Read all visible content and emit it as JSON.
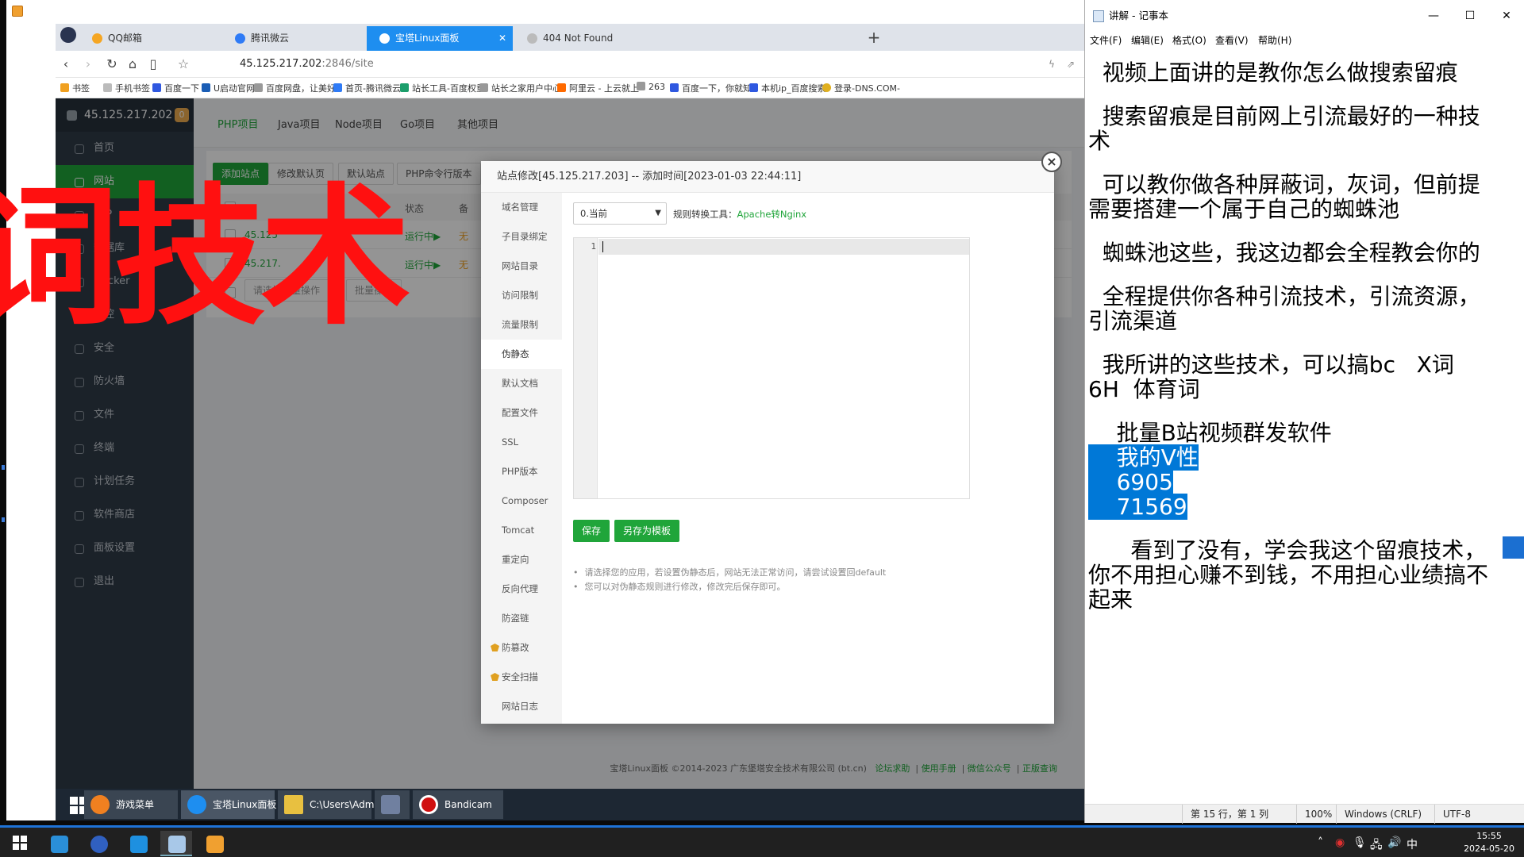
{
  "browser": {
    "tabs": [
      {
        "label": "QQ邮箱",
        "color": "#f5a623"
      },
      {
        "label": "腾讯微云",
        "color": "#2f7bf6"
      },
      {
        "label": "宝塔Linux面板",
        "color": "#1e8ef0"
      },
      {
        "label": "404 Not Found",
        "color": "#888888"
      }
    ],
    "new_tab": "+",
    "url_host": "45.125.217.202",
    "url_path": ":2846/site",
    "bookmarks": [
      "书签",
      "手机书签",
      "百度一下",
      "U启动官网",
      "百度网盘，让美好",
      "首页-腾讯微云",
      "站长工具-百度权重",
      "站长之家用户中心",
      "阿里云 - 上云就上",
      "263",
      "百度一下，你就知",
      "本机ip_百度搜索",
      "登录-DNS.COM-"
    ]
  },
  "bt": {
    "server_ip": "45.125.217.202",
    "badge": "0",
    "sidebar": [
      "首页",
      "网站",
      "FTP",
      "数据库",
      "Docker",
      "监控",
      "安全",
      "防火墙",
      "文件",
      "终端",
      "计划任务",
      "软件商店",
      "面板设置",
      "退出"
    ],
    "top_tabs": [
      "PHP项目",
      "Java项目",
      "Node项目",
      "Go项目",
      "其他项目"
    ],
    "toolbar": [
      "添加站点",
      "修改默认页",
      "默认站点",
      "PHP命令行版本"
    ],
    "status_header": "状态",
    "backup_header": "备",
    "rows": [
      {
        "site": "45.125",
        "status": "运行中▶",
        "backup": "无"
      },
      {
        "site": "45.217.",
        "status": "运行中▶",
        "backup": "无"
      }
    ],
    "batch_select": "请选择批量操作",
    "batch_btn": "批量操作",
    "footer_copy": "宝塔Linux面板 ©2014-2023 广东堡塔安全技术有限公司 (bt.cn)",
    "footer_links": [
      "论坛求助",
      "使用手册",
      "微信公众号",
      "正版查询"
    ]
  },
  "modal": {
    "title": "站点修改[45.125.217.203] -- 添加时间[2023-01-03 22:44:11]",
    "close": "×",
    "menu": [
      "域名管理",
      "子目录绑定",
      "网站目录",
      "访问限制",
      "流量限制",
      "伪静态",
      "默认文档",
      "配置文件",
      "SSL",
      "PHP版本",
      "Composer",
      "Tomcat",
      "重定向",
      "反向代理",
      "防盗链",
      "防篡改",
      "安全扫描",
      "网站日志"
    ],
    "rewrite_selected": "0.当前",
    "convert_label": "规则转换工具：",
    "convert_link": "Apache转Nginx",
    "line_number": "1",
    "save_btn": "保存",
    "save_template_btn": "另存为模板",
    "tips": [
      "请选择您的应用，若设置伪静态后，网站无法正常访问，请尝试设置回default",
      "您可以对伪静态规则进行修改，修改完后保存即可。"
    ]
  },
  "overlay_text": "词技术",
  "inner_taskbar": [
    {
      "label": "游戏菜单",
      "color": "#f08020"
    },
    {
      "label": "宝塔Linux面板",
      "color": "#1e8ef0"
    },
    {
      "label": "C:\\Users\\Admini...",
      "color": "#e8c040"
    },
    {
      "label": "",
      "color": "#7080a0"
    },
    {
      "label": "Bandicam",
      "color": "#d01010"
    }
  ],
  "notepad": {
    "title": "讲解 - 记事本",
    "menu": [
      "文件(F)",
      "编辑(E)",
      "格式(O)",
      "查看(V)",
      "帮助(H)"
    ],
    "lines": [
      {
        "text": "  视频上面讲的是教你怎么做搜索留痕",
        "sel": false
      },
      {
        "text": "",
        "sel": false
      },
      {
        "text": "  搜索留痕是目前网上引流最好的一种技",
        "sel": false
      },
      {
        "text": "术",
        "sel": false
      },
      {
        "text": "",
        "sel": false
      },
      {
        "text": "  可以教你做各种屏蔽词，灰词，但前提",
        "sel": false
      },
      {
        "text": "需要搭建一个属于自己的蜘蛛池",
        "sel": false
      },
      {
        "text": "",
        "sel": false
      },
      {
        "text": "  蜘蛛池这些，我这边都会全程教会你的",
        "sel": false
      },
      {
        "text": "",
        "sel": false
      },
      {
        "text": "  全程提供你各种引流技术，引流资源，",
        "sel": false
      },
      {
        "text": "引流渠道",
        "sel": false
      },
      {
        "text": "",
        "sel": false
      },
      {
        "text": "  我所讲的这些技术，可以搞bc   X词",
        "sel": false
      },
      {
        "text": "6H  体育词",
        "sel": false
      },
      {
        "text": "",
        "sel": false
      },
      {
        "text": "    批量B站视频群发软件",
        "sel": false
      },
      {
        "text": "    我的V性",
        "sel": true
      },
      {
        "text": "    6905",
        "sel": true
      },
      {
        "text": "    71569",
        "sel": true
      },
      {
        "text": "",
        "sel": false
      },
      {
        "text": "      看到了没有，学会我这个留痕技术，",
        "sel": false
      },
      {
        "text": "你不用担心赚不到钱，不用担心业绩搞不",
        "sel": false
      },
      {
        "text": "起来",
        "sel": false
      }
    ],
    "status": [
      "第 15 行，第 1 列",
      "100%",
      "Windows (CRLF)",
      "UTF-8"
    ]
  },
  "tray": {
    "ime": "中",
    "time": "15:55",
    "date": "2024-05-20"
  }
}
